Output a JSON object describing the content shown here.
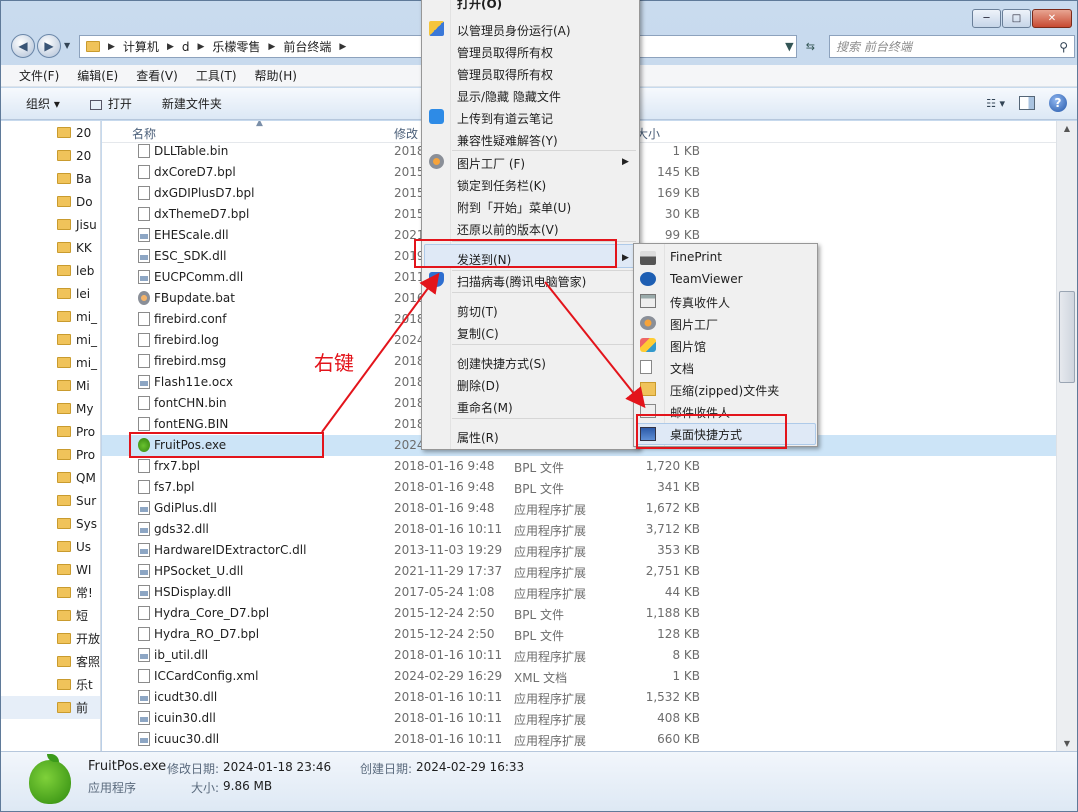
{
  "window": {
    "controls": {
      "minimize": "─",
      "maximize": "□",
      "close": "✕"
    }
  },
  "address": {
    "crumbs": [
      "计算机",
      "d",
      "乐檬零售",
      "前台终端"
    ],
    "search_placeholder": "搜索 前台终端"
  },
  "menubar": [
    "文件(F)",
    "编辑(E)",
    "查看(V)",
    "工具(T)",
    "帮助(H)"
  ],
  "toolbar": {
    "organize": "组织 ▾",
    "open": "打开",
    "new_folder": "新建文件夹"
  },
  "nav_items": [
    "20",
    "20",
    "Ba",
    "Do",
    "Jisu",
    "KK",
    "leb",
    "lei",
    "mi_",
    "mi_",
    "mi_",
    "Mi",
    "My",
    "Pro",
    "Pro",
    "QM",
    "Sur",
    "Sys",
    "Us",
    "WI",
    "常!",
    "短",
    "开放",
    "客照",
    "乐t",
    "前",
    "",
    ""
  ],
  "columns": {
    "name": "名称",
    "date": "修改",
    "type": "",
    "size": "大小"
  },
  "files": [
    {
      "name": "DLLTable.bin",
      "date": "2018",
      "type": "",
      "size": "1 KB",
      "icon": "file"
    },
    {
      "name": "dxCoreD7.bpl",
      "date": "2015",
      "type": "",
      "size": "145 KB",
      "icon": "file"
    },
    {
      "name": "dxGDIPlusD7.bpl",
      "date": "2015",
      "type": "",
      "size": "169 KB",
      "icon": "file"
    },
    {
      "name": "dxThemeD7.bpl",
      "date": "2015",
      "type": "",
      "size": "30 KB",
      "icon": "file"
    },
    {
      "name": "EHEScale.dll",
      "date": "2021",
      "type": "",
      "size": "99 KB",
      "icon": "dll"
    },
    {
      "name": "ESC_SDK.dll",
      "date": "2019",
      "type": "",
      "size": "",
      "icon": "dll"
    },
    {
      "name": "EUCPComm.dll",
      "date": "2011",
      "type": "",
      "size": "",
      "icon": "dll"
    },
    {
      "name": "FBupdate.bat",
      "date": "2016",
      "type": "",
      "size": "",
      "icon": "gear"
    },
    {
      "name": "firebird.conf",
      "date": "2018",
      "type": "",
      "size": "",
      "icon": "file"
    },
    {
      "name": "firebird.log",
      "date": "2024",
      "type": "",
      "size": "",
      "icon": "file"
    },
    {
      "name": "firebird.msg",
      "date": "2018",
      "type": "",
      "size": "",
      "icon": "file"
    },
    {
      "name": "Flash11e.ocx",
      "date": "2018",
      "type": "",
      "size": "",
      "icon": "dll"
    },
    {
      "name": "fontCHN.bin",
      "date": "2018",
      "type": "",
      "size": "",
      "icon": "file"
    },
    {
      "name": "fontENG.BIN",
      "date": "2018",
      "type": "",
      "size": "",
      "icon": "file"
    },
    {
      "name": "FruitPos.exe",
      "date": "2024",
      "type": "",
      "size": "",
      "icon": "exe"
    },
    {
      "name": "frx7.bpl",
      "date": "2018-01-16 9:48",
      "type": "BPL 文件",
      "size": "1,720 KB",
      "icon": "file"
    },
    {
      "name": "fs7.bpl",
      "date": "2018-01-16 9:48",
      "type": "BPL 文件",
      "size": "341 KB",
      "icon": "file"
    },
    {
      "name": "GdiPlus.dll",
      "date": "2018-01-16 9:48",
      "type": "应用程序扩展",
      "size": "1,672 KB",
      "icon": "dll"
    },
    {
      "name": "gds32.dll",
      "date": "2018-01-16 10:11",
      "type": "应用程序扩展",
      "size": "3,712 KB",
      "icon": "dll"
    },
    {
      "name": "HardwareIDExtractorC.dll",
      "date": "2013-11-03 19:29",
      "type": "应用程序扩展",
      "size": "353 KB",
      "icon": "dll"
    },
    {
      "name": "HPSocket_U.dll",
      "date": "2021-11-29 17:37",
      "type": "应用程序扩展",
      "size": "2,751 KB",
      "icon": "dll"
    },
    {
      "name": "HSDisplay.dll",
      "date": "2017-05-24 1:08",
      "type": "应用程序扩展",
      "size": "44 KB",
      "icon": "dll"
    },
    {
      "name": "Hydra_Core_D7.bpl",
      "date": "2015-12-24 2:50",
      "type": "BPL 文件",
      "size": "1,188 KB",
      "icon": "file"
    },
    {
      "name": "Hydra_RO_D7.bpl",
      "date": "2015-12-24 2:50",
      "type": "BPL 文件",
      "size": "128 KB",
      "icon": "file"
    },
    {
      "name": "ib_util.dll",
      "date": "2018-01-16 10:11",
      "type": "应用程序扩展",
      "size": "8 KB",
      "icon": "dll"
    },
    {
      "name": "ICCardConfig.xml",
      "date": "2024-02-29 16:29",
      "type": "XML 文档",
      "size": "1 KB",
      "icon": "file"
    },
    {
      "name": "icudt30.dll",
      "date": "2018-01-16 10:11",
      "type": "应用程序扩展",
      "size": "1,532 KB",
      "icon": "dll"
    },
    {
      "name": "icuin30.dll",
      "date": "2018-01-16 10:11",
      "type": "应用程序扩展",
      "size": "408 KB",
      "icon": "dll"
    },
    {
      "name": "icuuc30.dll",
      "date": "2018-01-16 10:11",
      "type": "应用程序扩展",
      "size": "660 KB",
      "icon": "dll"
    }
  ],
  "context_menu": {
    "open": "打开(O)",
    "run_as_admin": "以管理员身份运行(A)",
    "take_owner_1": "管理员取得所有权",
    "take_owner_2": "管理员取得所有权",
    "show_hide": "显示/隐藏 隐藏文件",
    "youdao": "上传到有道云笔记",
    "compat": "兼容性疑难解答(Y)",
    "picture_factory": "图片工厂 (F)",
    "pin_taskbar": "锁定到任务栏(K)",
    "pin_start": "附到「开始」菜单(U)",
    "restore": "还原以前的版本(V)",
    "send_to": "发送到(N)",
    "scan": "扫描病毒(腾讯电脑管家)",
    "cut": "剪切(T)",
    "copy": "复制(C)",
    "shortcut": "创建快捷方式(S)",
    "delete": "删除(D)",
    "rename": "重命名(M)",
    "properties": "属性(R)"
  },
  "send_to_menu": [
    "FinePrint",
    "TeamViewer",
    "传真收件人",
    "图片工厂",
    "图片馆",
    "文档",
    "压缩(zipped)文件夹",
    "邮件收件人",
    "桌面快捷方式"
  ],
  "annotation": {
    "label": "右键",
    "color": "#e3141b"
  },
  "details": {
    "file_name": "FruitPos.exe",
    "modified_label": "修改日期:",
    "modified": "2024-01-18 23:46",
    "created_label": "创建日期:",
    "created": "2024-02-29 16:33",
    "file_type": "应用程序",
    "size_label": "大小:",
    "size": "9.86 MB"
  }
}
